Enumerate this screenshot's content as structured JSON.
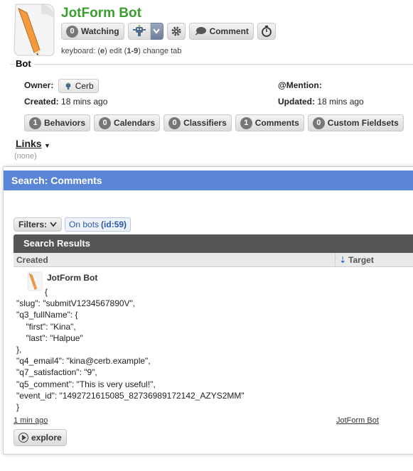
{
  "header": {
    "title": "JotForm Bot",
    "watching_count": "0",
    "watching_label": "Watching",
    "comment_label": "Comment",
    "keyboard_hint": {
      "prefix": "keyboard: (",
      "edit_key": "e",
      "edit_text": ") edit (",
      "tab_keys": "1-9",
      "tab_text": ") change tab"
    }
  },
  "bot": {
    "legend": "Bot",
    "owner_label": "Owner:",
    "owner_value": "Cerb",
    "mention_label": "@Mention:",
    "created_label": "Created:",
    "created_value": "18 mins ago",
    "updated_label": "Updated:",
    "updated_value": "18 mins ago",
    "links": [
      {
        "count": "1",
        "label": "Behaviors"
      },
      {
        "count": "0",
        "label": "Calendars"
      },
      {
        "count": "0",
        "label": "Classifiers"
      },
      {
        "count": "1",
        "label": "Comments"
      },
      {
        "count": "0",
        "label": "Custom Fieldsets"
      }
    ]
  },
  "links_section": {
    "title": "Links",
    "empty": "(none)"
  },
  "search": {
    "title": "Search: Comments",
    "filters_label": "Filters:",
    "filter_chip_text": "On bots",
    "filter_chip_id": "(id:59)",
    "results_title": "Search Results",
    "columns": {
      "created": "Created",
      "target": "Target"
    },
    "result": {
      "author": "JotForm Bot",
      "body": "            {\n\"slug\": \"submitV1234567890V\",\n\"q3_fullName\": {\n    \"first\": \"Kina\",\n    \"last\": \"Halpue\"\n},\n\"q4_email4\": \"kina@cerb.example\",\n\"q7_satisfaction\": \"9\",\n\"q5_comment\": \"This is very useful!\",\n\"event_id\": \"1492721615085_82736989172142_AZYS2MM\"\n}",
      "time": "1 min ago",
      "target": "JotForm Bot"
    },
    "explore_label": "explore"
  },
  "colors": {
    "title_green": "#3a9e2f",
    "panel_blue": "#5b86d8",
    "results_header": "#555555"
  }
}
